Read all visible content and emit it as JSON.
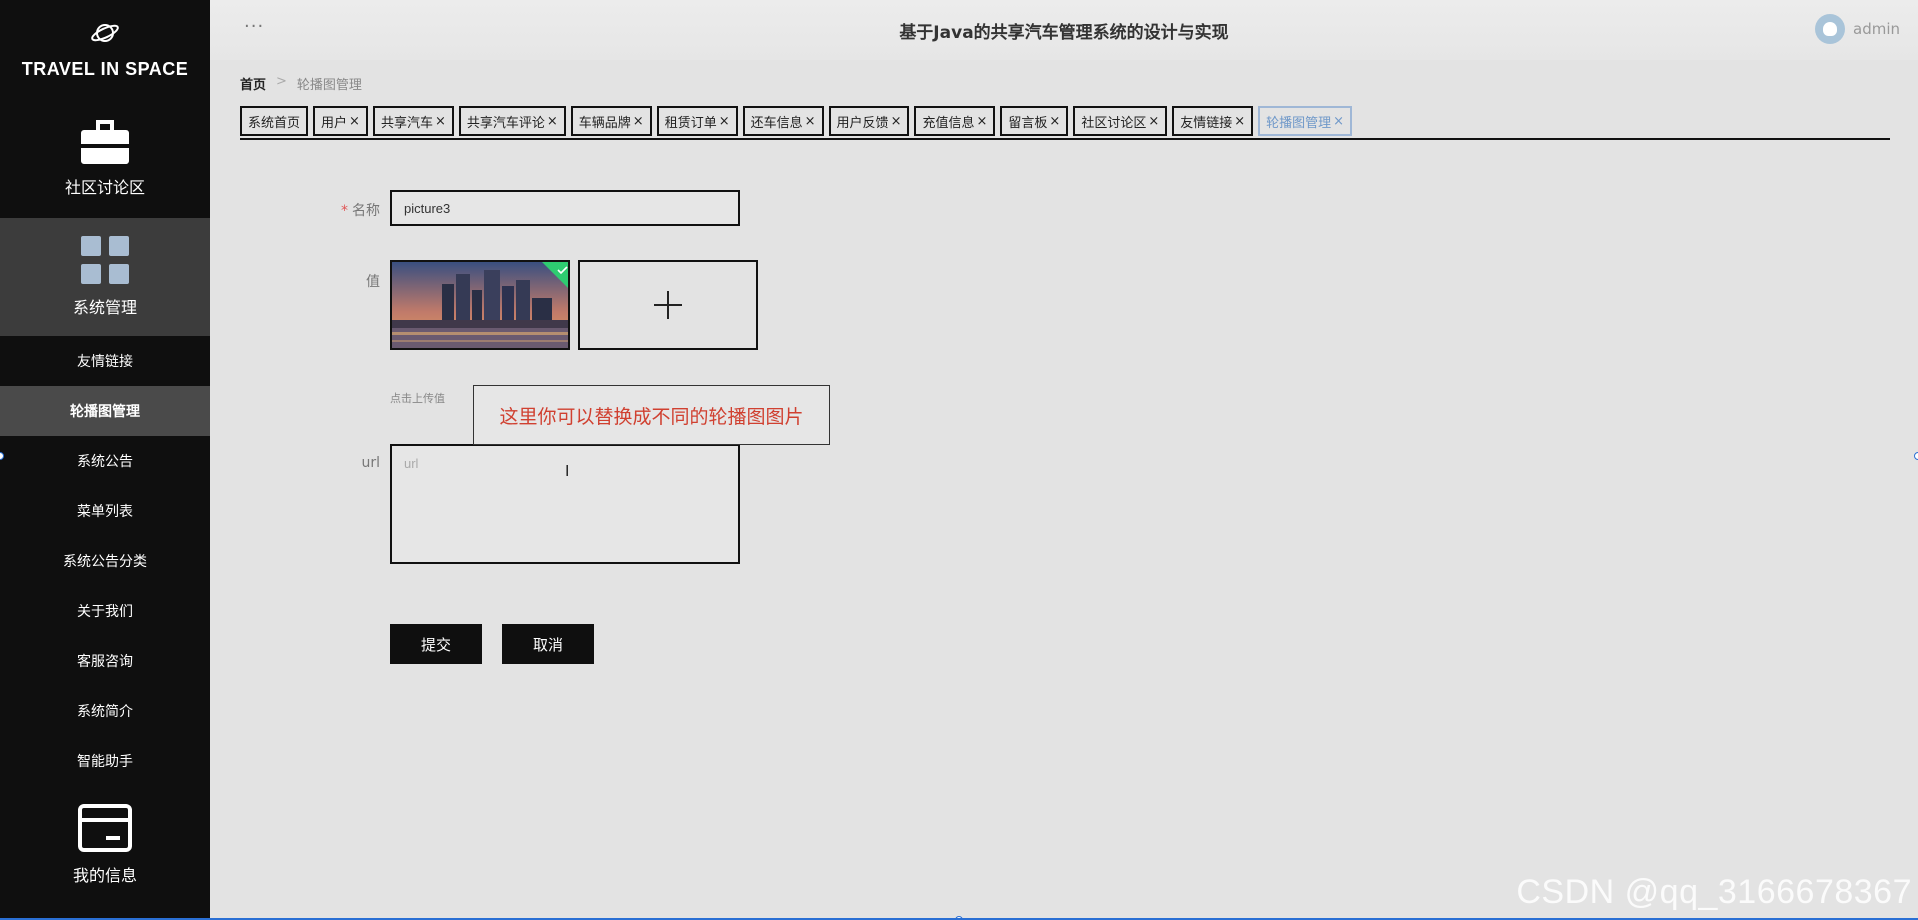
{
  "sidebar": {
    "brand": "TRAVEL IN SPACE",
    "big_items": [
      {
        "label": "社区讨论区",
        "icon": "briefcase-icon"
      },
      {
        "label": "系统管理",
        "icon": "grid-icon"
      },
      {
        "label": "我的信息",
        "icon": "card-icon"
      }
    ],
    "sub_items": [
      "友情链接",
      "轮播图管理",
      "系统公告",
      "菜单列表",
      "系统公告分类",
      "关于我们",
      "客服咨询",
      "系统简介",
      "智能助手"
    ],
    "active_sub": "轮播图管理"
  },
  "header": {
    "menu_dots": "···",
    "title": "基于Java的共享汽车管理系统的设计与实现",
    "username": "admin"
  },
  "breadcrumb": {
    "home": "首页",
    "separator": ">",
    "current": "轮播图管理"
  },
  "tabs": [
    {
      "label": "系统首页",
      "closable": false
    },
    {
      "label": "用户",
      "closable": true
    },
    {
      "label": "共享汽车",
      "closable": true
    },
    {
      "label": "共享汽车评论",
      "closable": true
    },
    {
      "label": "车辆品牌",
      "closable": true
    },
    {
      "label": "租赁订单",
      "closable": true
    },
    {
      "label": "还车信息",
      "closable": true
    },
    {
      "label": "用户反馈",
      "closable": true
    },
    {
      "label": "充值信息",
      "closable": true
    },
    {
      "label": "留言板",
      "closable": true
    },
    {
      "label": "社区讨论区",
      "closable": true
    },
    {
      "label": "友情链接",
      "closable": true
    },
    {
      "label": "轮播图管理",
      "closable": true,
      "active": true
    }
  ],
  "tab_close_glyph": "×",
  "form": {
    "name_label": "名称",
    "required_mark": "*",
    "name_value": "picture3",
    "value_label": "值",
    "upload_hint": "点击上传值",
    "url_label": "url",
    "url_placeholder": "url",
    "submit": "提交",
    "cancel": "取消"
  },
  "annotation": "这里你可以替换成不同的轮播图图片",
  "watermark": "CSDN @qq_3166678367",
  "colors": {
    "sidebar_bg": "#0f0f0f",
    "content_bg": "#e3e3e3",
    "active_tab": "#6f98c9",
    "annotation_text": "#d04030",
    "upload_ok": "#2ecc71"
  }
}
